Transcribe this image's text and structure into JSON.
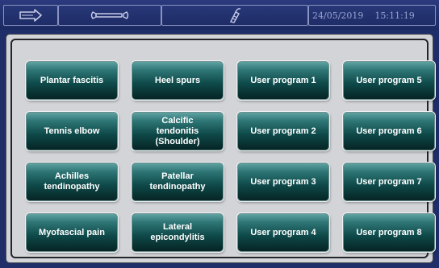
{
  "header": {
    "icons": [
      "arrow-right-icon",
      "wrench-icon",
      "handpiece-icon"
    ],
    "date": "24/05/2019",
    "time": "15:11:19"
  },
  "programs": [
    [
      "Plantar fascitis",
      "Heel spurs",
      "User program 1",
      "User program 5"
    ],
    [
      "Tennis elbow",
      "Calcific\ntendonitis\n(Shoulder)",
      "User program 2",
      "User program 6"
    ],
    [
      "Achilles\ntendinopathy",
      "Patellar\ntendinopathy",
      "User program 3",
      "User program 7"
    ],
    [
      "Myofascial pain",
      "Lateral\nepicondylitis",
      "User program 4",
      "User program 8"
    ]
  ],
  "colors": {
    "header_bg": "#1f2d68",
    "panel_bg": "#d2d4d8",
    "button_top": "#5fa2a2",
    "button_bottom": "#062424",
    "button_text": "#ffffff"
  }
}
